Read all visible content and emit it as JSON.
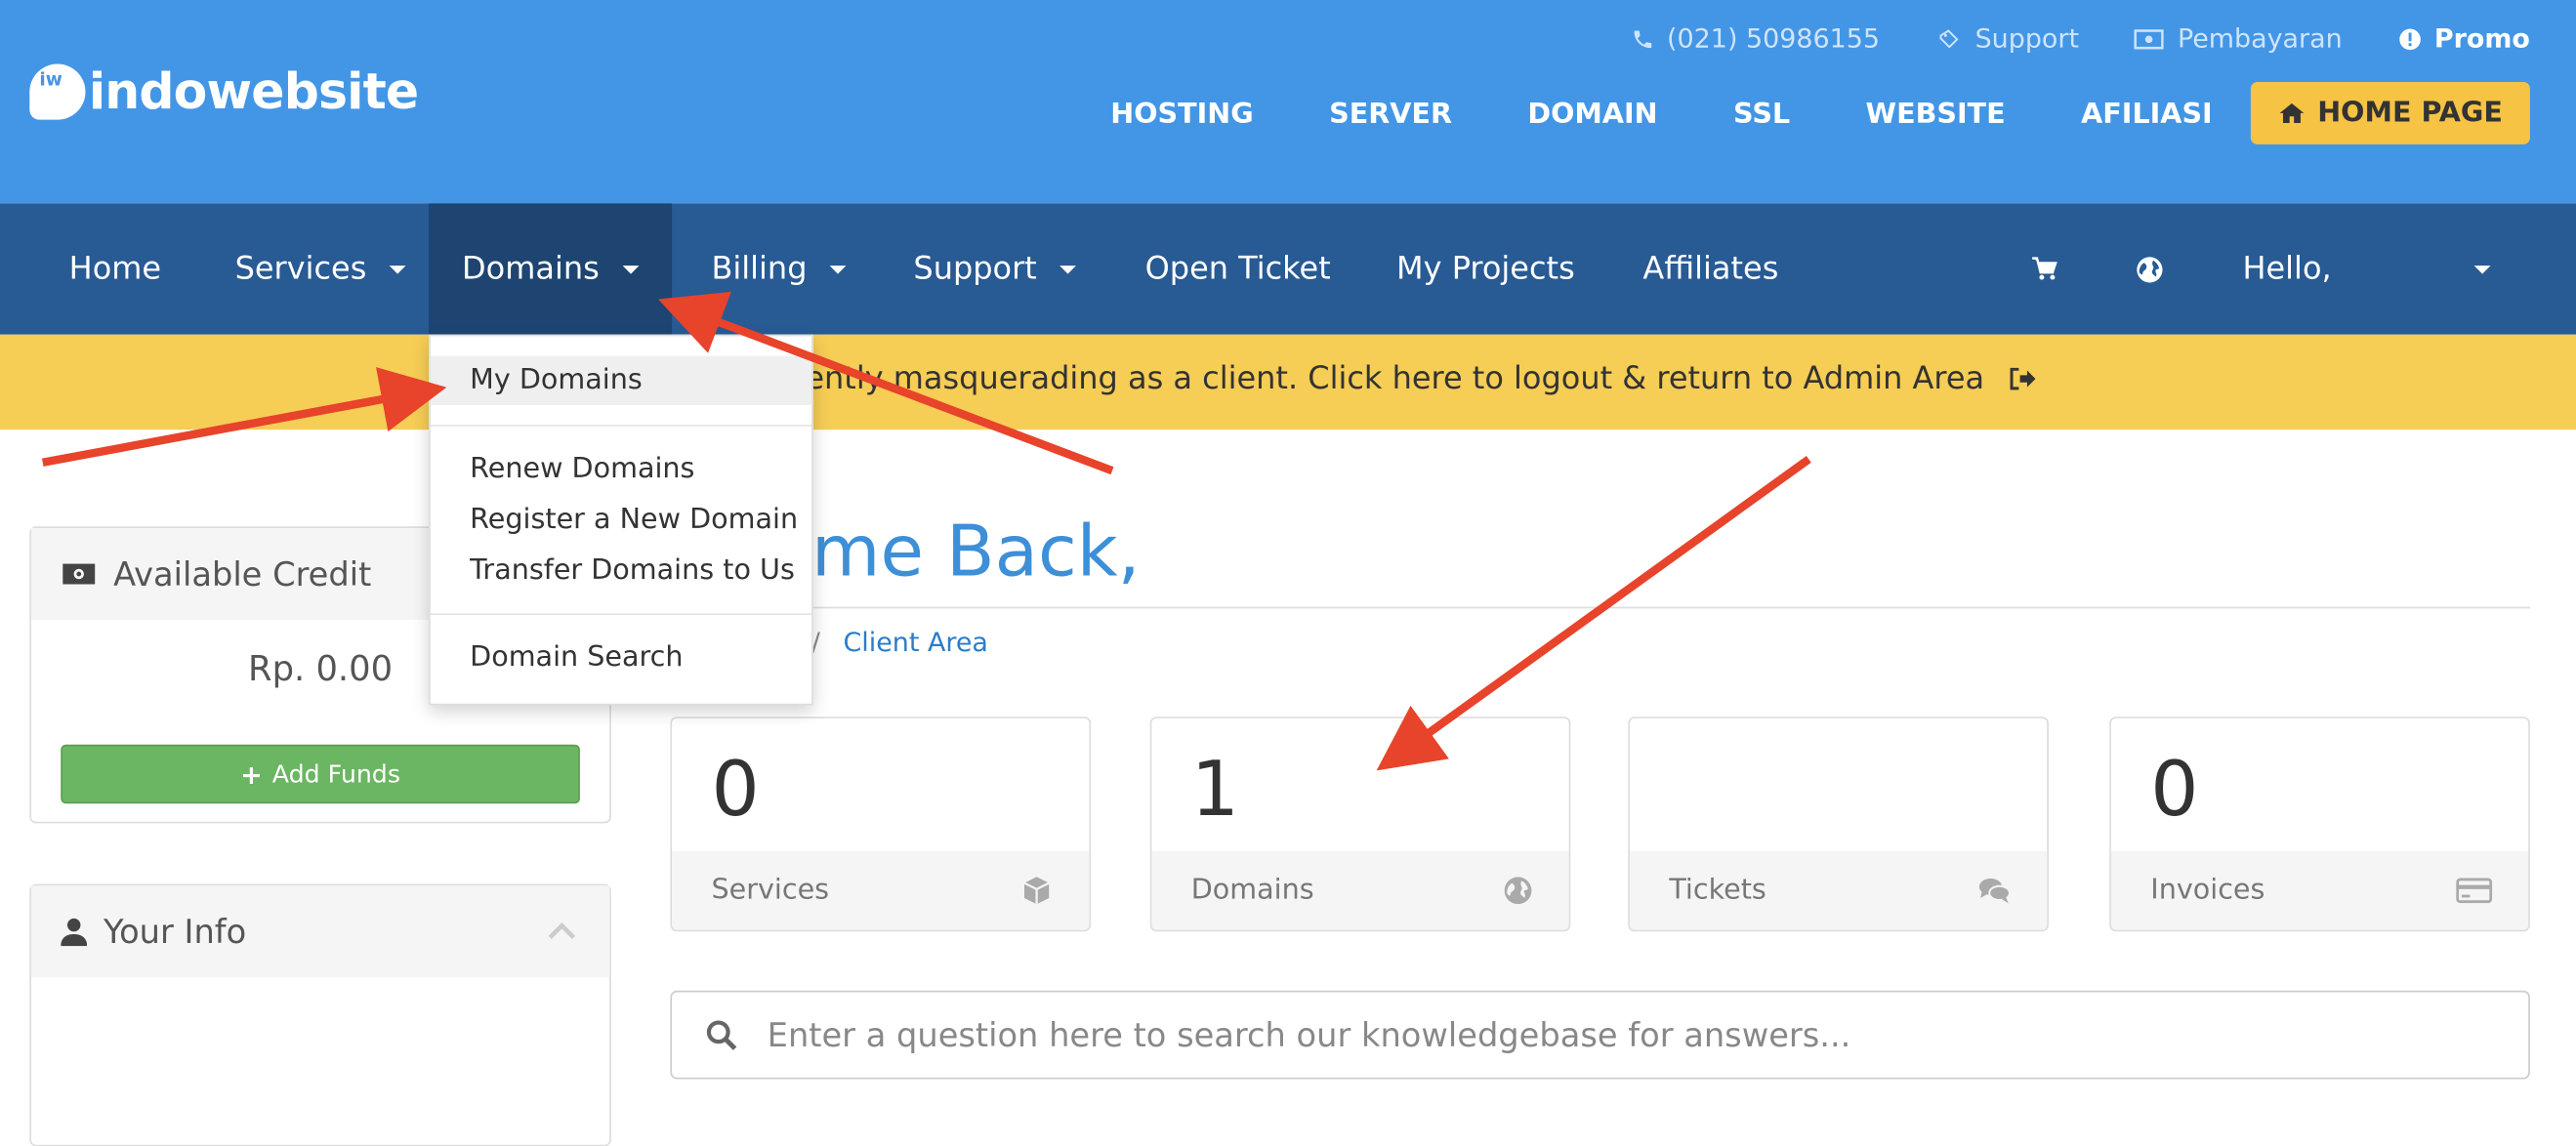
{
  "header": {
    "brand": "indowebsite",
    "brand_mark": "iw",
    "util": {
      "phone": "(021) 50986155",
      "support": "Support",
      "payment": "Pembayaran",
      "promo": "Promo"
    },
    "main_nav": [
      "HOSTING",
      "SERVER",
      "DOMAIN",
      "SSL",
      "WEBSITE",
      "AFILIASI"
    ],
    "home_button": "HOME PAGE"
  },
  "navbar": {
    "home": "Home",
    "services": "Services",
    "domains": "Domains",
    "billing": "Billing",
    "support": "Support",
    "open_ticket": "Open Ticket",
    "my_projects": "My Projects",
    "affiliates": "Affiliates",
    "hello": "Hello,"
  },
  "banner": {
    "text": "ently masquerading as a client. Click here to logout & return to Admin Area"
  },
  "dropdown": {
    "my_domains": "My Domains",
    "renew": "Renew Domains",
    "register": "Register a New Domain",
    "transfer": "Transfer Domains to Us",
    "search": "Domain Search"
  },
  "sidebar": {
    "credit_title": "Available Credit",
    "credit_value": "Rp. 0.00",
    "add_funds": "Add Funds",
    "info_title": "Your Info"
  },
  "main": {
    "welcome": "come Back,",
    "breadcrumb_home": "e",
    "breadcrumb_sep": "/",
    "breadcrumb_current": "Client Area",
    "tiles": [
      {
        "value": "0",
        "label": "Services"
      },
      {
        "value": "1",
        "label": "Domains"
      },
      {
        "value": "",
        "label": "Tickets"
      },
      {
        "value": "0",
        "label": "Invoices"
      }
    ],
    "search_placeholder": "Enter a question here to search our knowledgebase for answers..."
  },
  "colors": {
    "header_bg": "#4396e6",
    "navbar_bg": "#285a94",
    "banner_bg": "#f6cd55",
    "home_button_bg": "#f6c344",
    "add_funds_bg": "#6bb662",
    "arrow": "#e8432b"
  }
}
